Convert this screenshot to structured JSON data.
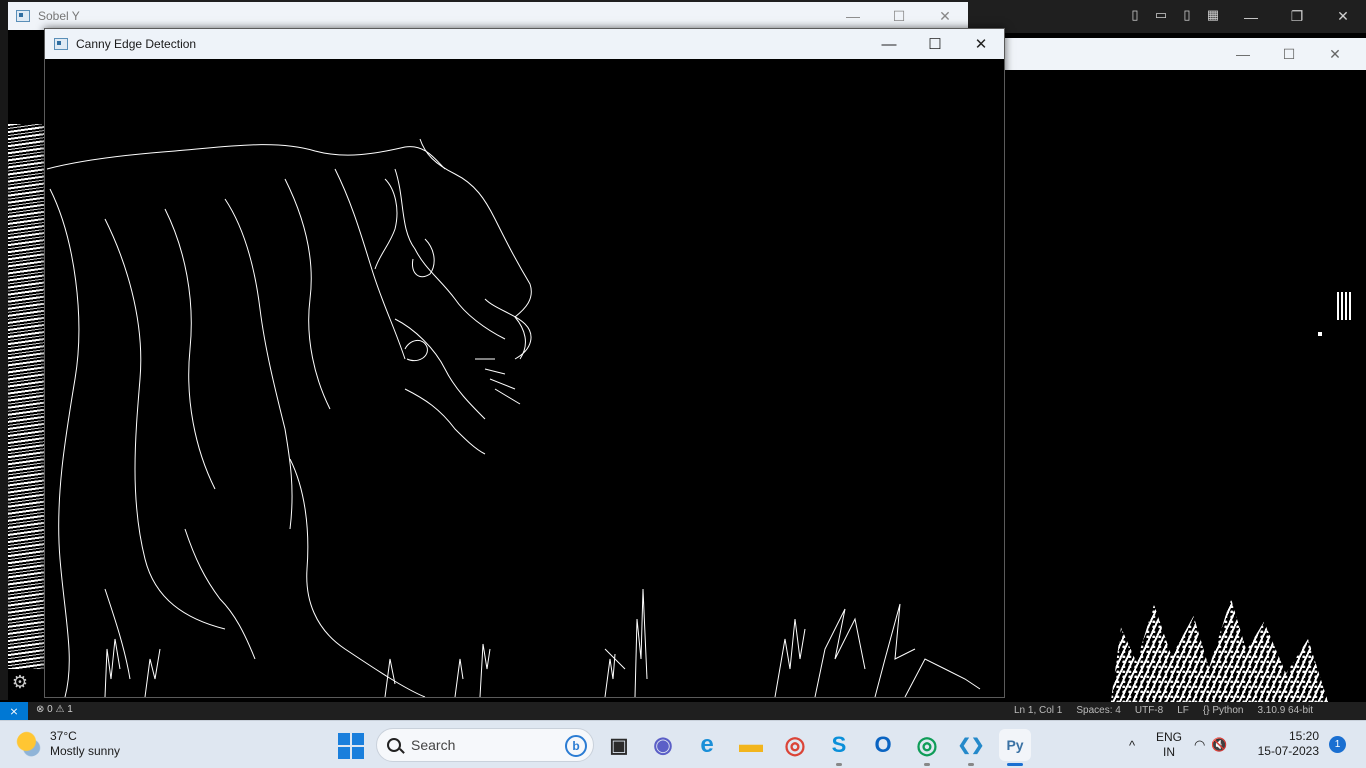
{
  "windows": {
    "sobel": {
      "title": "Sobel Y",
      "controls": {
        "minimize": "—",
        "maximize": "☐",
        "close": "✕"
      }
    },
    "canny": {
      "title": "Canny Edge Detection",
      "controls": {
        "minimize": "—",
        "maximize": "☐",
        "close": "✕"
      }
    },
    "right": {
      "controls": {
        "minimize": "—",
        "maximize": "☐",
        "close": "✕"
      }
    }
  },
  "vscode": {
    "layout_icons": [
      "panel-left-icon",
      "panel-bottom-icon",
      "panel-right-icon",
      "layout-customize-icon"
    ],
    "window_controls": {
      "minimize": "—",
      "restore": "❐",
      "close": "✕"
    },
    "status": {
      "remote": "⨯",
      "errors": "0",
      "warnings": "1",
      "items": [
        "Ln 1, Col 1",
        "Spaces: 4",
        "UTF-8",
        "LF",
        "{} Python",
        "3.10.9 64-bit"
      ]
    }
  },
  "taskbar": {
    "weather": {
      "temp": "37°C",
      "desc": "Mostly sunny"
    },
    "search": {
      "placeholder": "Search",
      "bing": "b"
    },
    "apps": [
      {
        "name": "task-view-button",
        "glyph": "▣",
        "color": "#2b2b2b"
      },
      {
        "name": "teams-button",
        "glyph": "◉",
        "color": "#5b5fc7"
      },
      {
        "name": "edge-button",
        "glyph": "e",
        "color": "#1a8fd8"
      },
      {
        "name": "file-explorer-button",
        "glyph": "▬",
        "color": "#f2b51d"
      },
      {
        "name": "chrome-button",
        "glyph": "◎",
        "color": "#db4437"
      },
      {
        "name": "skype-button",
        "glyph": "S",
        "color": "#0a8fd9"
      },
      {
        "name": "outlook-button",
        "glyph": "O",
        "color": "#0a64c2"
      },
      {
        "name": "chrome-profile-button",
        "glyph": "◎",
        "color": "#0f9d58"
      },
      {
        "name": "vscode-button",
        "glyph": "❮❯",
        "color": "#2489ca"
      },
      {
        "name": "python-button",
        "glyph": "Py",
        "color": "#3b72a4"
      }
    ],
    "tray": {
      "chevron": "^",
      "lang_line1": "ENG",
      "lang_line2": "IN",
      "wifi": "◠",
      "volume": "🔇"
    },
    "clock": {
      "time": "15:20",
      "date": "15-07-2023"
    },
    "notifications": "1"
  }
}
